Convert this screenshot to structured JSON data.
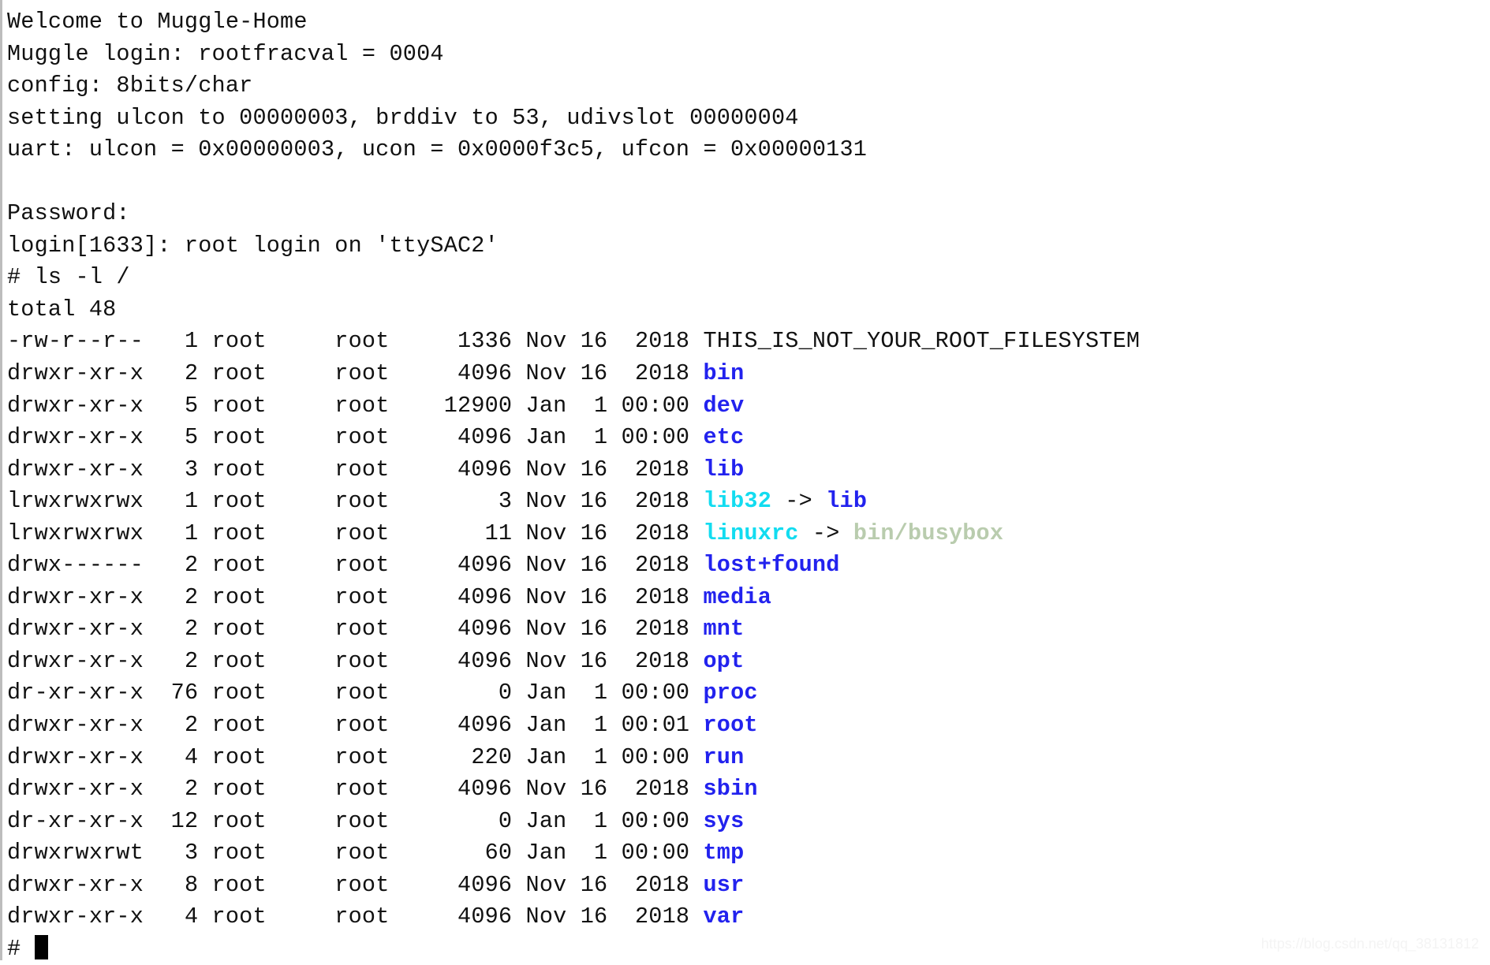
{
  "terminal": {
    "boot_lines": [
      "Welcome to Muggle-Home",
      "Muggle login: rootfracval = 0004",
      "config: 8bits/char",
      "setting ulcon to 00000003, brddiv to 53, udivslot 00000004",
      "uart: ulcon = 0x00000003, ucon = 0x0000f3c5, ufcon = 0x00000131",
      "",
      "Password:",
      "login[1633]: root login on 'ttySAC2'"
    ],
    "command_line": "# ls -l /",
    "total_line": "total 48",
    "prompt_symbol": "#",
    "colors": {
      "directory": "#2222ee",
      "symlink": "#12dcf0",
      "orphan_target": "#b9ccae",
      "regular_file": "#111111",
      "background": "#ffffff",
      "foreground": "#111111"
    },
    "listing": [
      {
        "perms": "-rw-r--r--",
        "links": "1",
        "owner": "root",
        "group": "root",
        "size": "1336",
        "month": "Nov",
        "day": "16",
        "time": "2018",
        "name": "THIS_IS_NOT_YOUR_ROOT_FILESYSTEM",
        "type": "file",
        "target": ""
      },
      {
        "perms": "drwxr-xr-x",
        "links": "2",
        "owner": "root",
        "group": "root",
        "size": "4096",
        "month": "Nov",
        "day": "16",
        "time": "2018",
        "name": "bin",
        "type": "dir",
        "target": ""
      },
      {
        "perms": "drwxr-xr-x",
        "links": "5",
        "owner": "root",
        "group": "root",
        "size": "12900",
        "month": "Jan",
        "day": "1",
        "time": "00:00",
        "name": "dev",
        "type": "dir",
        "target": ""
      },
      {
        "perms": "drwxr-xr-x",
        "links": "5",
        "owner": "root",
        "group": "root",
        "size": "4096",
        "month": "Jan",
        "day": "1",
        "time": "00:00",
        "name": "etc",
        "type": "dir",
        "target": ""
      },
      {
        "perms": "drwxr-xr-x",
        "links": "3",
        "owner": "root",
        "group": "root",
        "size": "4096",
        "month": "Nov",
        "day": "16",
        "time": "2018",
        "name": "lib",
        "type": "dir",
        "target": ""
      },
      {
        "perms": "lrwxrwxrwx",
        "links": "1",
        "owner": "root",
        "group": "root",
        "size": "3",
        "month": "Nov",
        "day": "16",
        "time": "2018",
        "name": "lib32",
        "type": "link",
        "target": "lib"
      },
      {
        "perms": "lrwxrwxrwx",
        "links": "1",
        "owner": "root",
        "group": "root",
        "size": "11",
        "month": "Nov",
        "day": "16",
        "time": "2018",
        "name": "linuxrc",
        "type": "orphan",
        "target": "bin/busybox"
      },
      {
        "perms": "drwx------",
        "links": "2",
        "owner": "root",
        "group": "root",
        "size": "4096",
        "month": "Nov",
        "day": "16",
        "time": "2018",
        "name": "lost+found",
        "type": "dir",
        "target": ""
      },
      {
        "perms": "drwxr-xr-x",
        "links": "2",
        "owner": "root",
        "group": "root",
        "size": "4096",
        "month": "Nov",
        "day": "16",
        "time": "2018",
        "name": "media",
        "type": "dir",
        "target": ""
      },
      {
        "perms": "drwxr-xr-x",
        "links": "2",
        "owner": "root",
        "group": "root",
        "size": "4096",
        "month": "Nov",
        "day": "16",
        "time": "2018",
        "name": "mnt",
        "type": "dir",
        "target": ""
      },
      {
        "perms": "drwxr-xr-x",
        "links": "2",
        "owner": "root",
        "group": "root",
        "size": "4096",
        "month": "Nov",
        "day": "16",
        "time": "2018",
        "name": "opt",
        "type": "dir",
        "target": ""
      },
      {
        "perms": "dr-xr-xr-x",
        "links": "76",
        "owner": "root",
        "group": "root",
        "size": "0",
        "month": "Jan",
        "day": "1",
        "time": "00:00",
        "name": "proc",
        "type": "dir",
        "target": ""
      },
      {
        "perms": "drwxr-xr-x",
        "links": "2",
        "owner": "root",
        "group": "root",
        "size": "4096",
        "month": "Jan",
        "day": "1",
        "time": "00:01",
        "name": "root",
        "type": "dir",
        "target": ""
      },
      {
        "perms": "drwxr-xr-x",
        "links": "4",
        "owner": "root",
        "group": "root",
        "size": "220",
        "month": "Jan",
        "day": "1",
        "time": "00:00",
        "name": "run",
        "type": "dir",
        "target": ""
      },
      {
        "perms": "drwxr-xr-x",
        "links": "2",
        "owner": "root",
        "group": "root",
        "size": "4096",
        "month": "Nov",
        "day": "16",
        "time": "2018",
        "name": "sbin",
        "type": "dir",
        "target": ""
      },
      {
        "perms": "dr-xr-xr-x",
        "links": "12",
        "owner": "root",
        "group": "root",
        "size": "0",
        "month": "Jan",
        "day": "1",
        "time": "00:00",
        "name": "sys",
        "type": "dir",
        "target": ""
      },
      {
        "perms": "drwxrwxrwt",
        "links": "3",
        "owner": "root",
        "group": "root",
        "size": "60",
        "month": "Jan",
        "day": "1",
        "time": "00:00",
        "name": "tmp",
        "type": "dir",
        "target": ""
      },
      {
        "perms": "drwxr-xr-x",
        "links": "8",
        "owner": "root",
        "group": "root",
        "size": "4096",
        "month": "Nov",
        "day": "16",
        "time": "2018",
        "name": "usr",
        "type": "dir",
        "target": ""
      },
      {
        "perms": "drwxr-xr-x",
        "links": "4",
        "owner": "root",
        "group": "root",
        "size": "4096",
        "month": "Nov",
        "day": "16",
        "time": "2018",
        "name": "var",
        "type": "dir",
        "target": ""
      }
    ]
  },
  "watermark": "https://blog.csdn.net/qq_38131812"
}
